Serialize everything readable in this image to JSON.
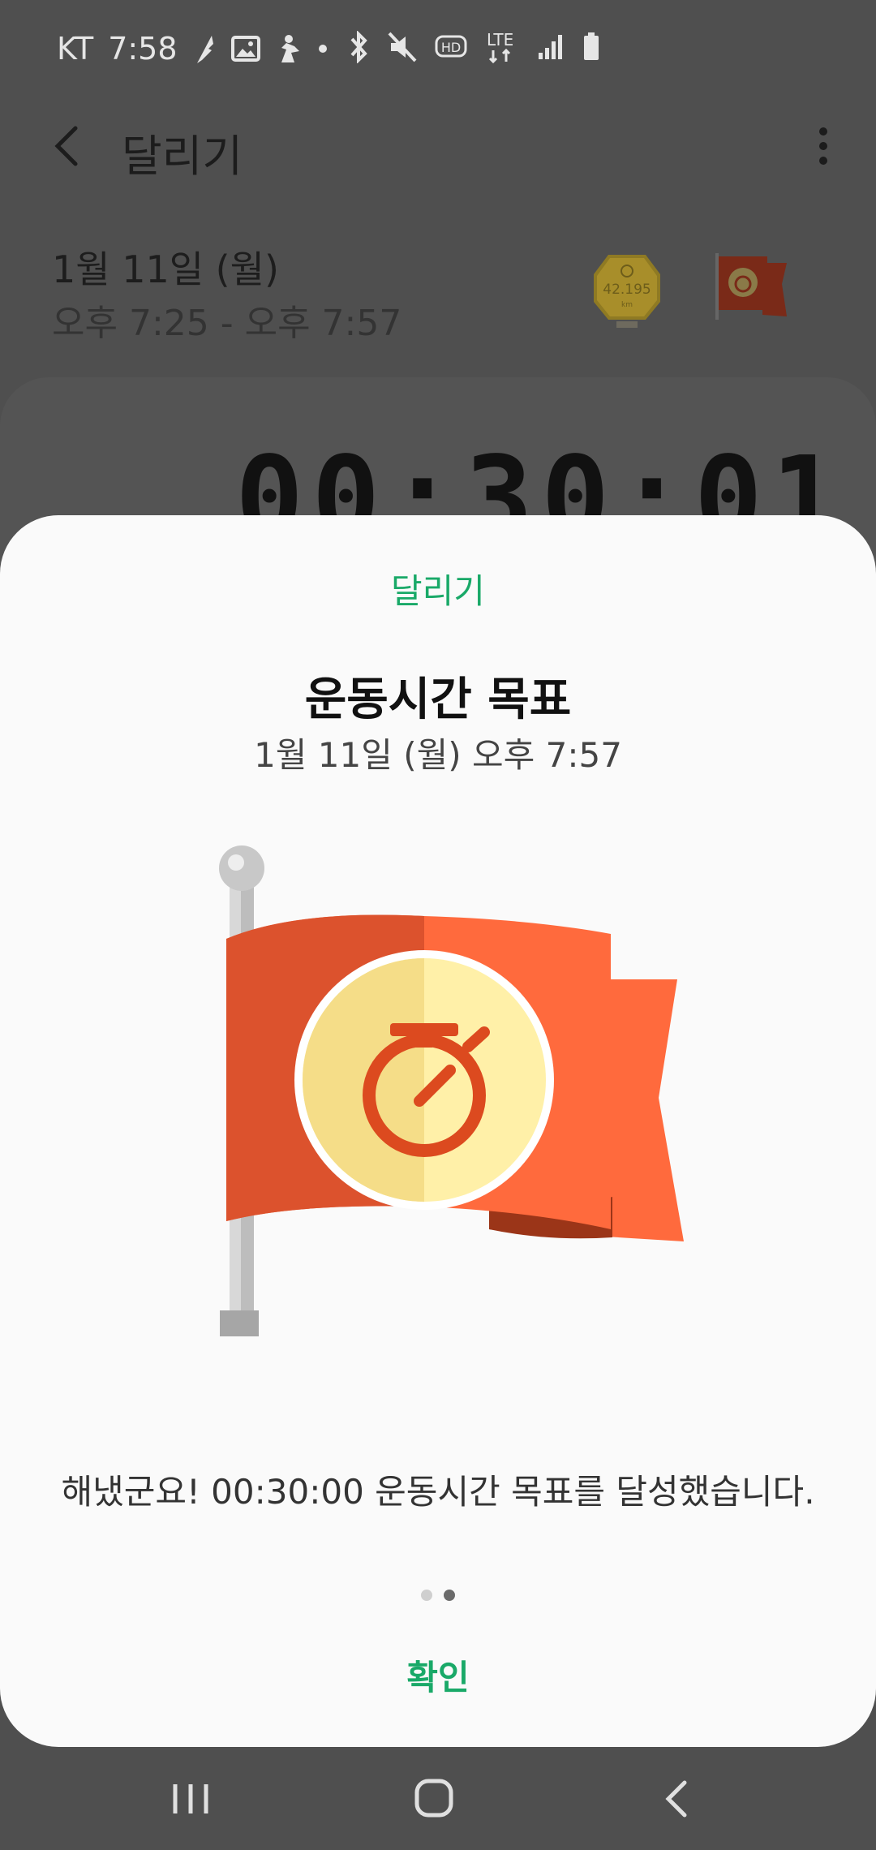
{
  "status_bar": {
    "carrier": "KT",
    "time": "7:58",
    "network_label": "LTE",
    "hd_label": "HD"
  },
  "app_bar": {
    "title": "달리기"
  },
  "workout": {
    "date": "1월 11일 (월)",
    "time_range": "오후 7:25 - 오후 7:57",
    "medal_label": "42.195",
    "medal_unit": "km",
    "duration": "00:30:01"
  },
  "dialog": {
    "category": "달리기",
    "title": "운동시간 목표",
    "subtitle": "1월 11일 (월) 오후 7:57",
    "message": "해냈군요! 00:30:00 운동시간 목표를 달성했습니다.",
    "page_count": 2,
    "active_page": 2,
    "confirm_label": "확인"
  },
  "colors": {
    "accent_green": "#19a968",
    "flag_red": "#ff6a3d",
    "flag_dark": "#dc522d",
    "stopwatch_gold": "#f5dd88"
  },
  "icons": [
    "back-icon",
    "more-vert-icon",
    "recents-icon",
    "home-icon",
    "nav-back-icon"
  ]
}
